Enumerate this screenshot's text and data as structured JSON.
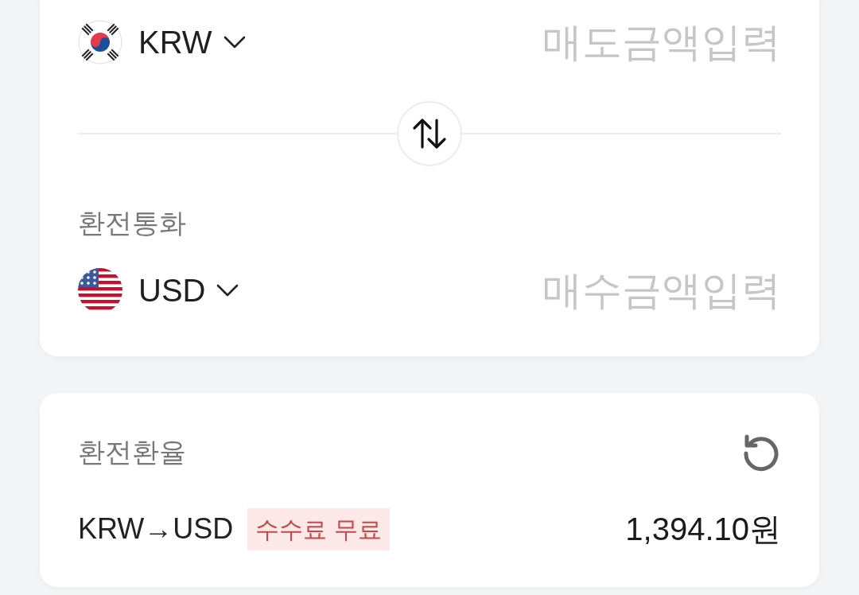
{
  "sell": {
    "currency": "KRW",
    "kind": "kr",
    "placeholder": "매도금액입력"
  },
  "target_label": "환전통화",
  "buy": {
    "currency": "USD",
    "kind": "us",
    "placeholder": "매수금액입력"
  },
  "rate": {
    "label": "환전환율",
    "pair": "KRW→USD",
    "badge": "수수료 무료",
    "amount": "1,394.10원"
  }
}
